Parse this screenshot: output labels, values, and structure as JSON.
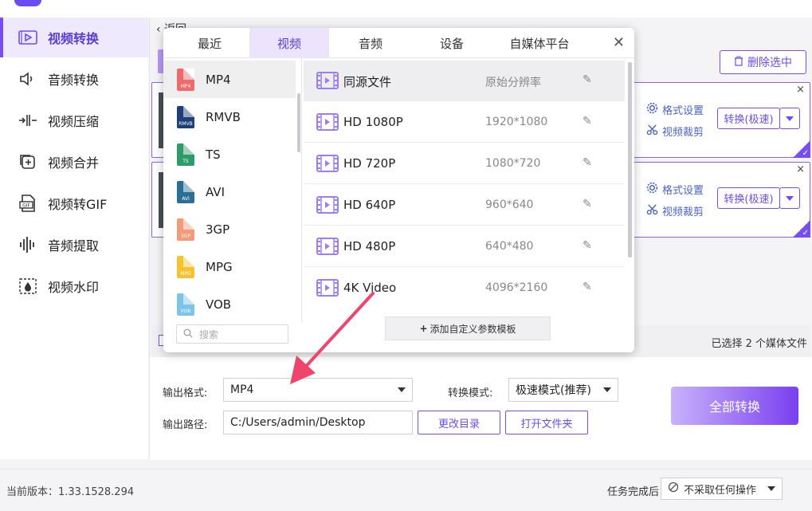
{
  "sidebar": {
    "items": [
      {
        "label": "视频转换",
        "icon": "video-convert-icon",
        "active": true
      },
      {
        "label": "音频转换",
        "icon": "audio-convert-icon"
      },
      {
        "label": "视频压缩",
        "icon": "video-compress-icon"
      },
      {
        "label": "视频合并",
        "icon": "video-merge-icon"
      },
      {
        "label": "视频转GIF",
        "icon": "gif-icon"
      },
      {
        "label": "音频提取",
        "icon": "audio-extract-icon"
      },
      {
        "label": "视频水印",
        "icon": "watermark-icon"
      }
    ]
  },
  "main": {
    "back_label": "返回",
    "delete_selected": "删除选中",
    "cards": [
      {
        "format_settings": "格式设置",
        "crop": "视频裁剪",
        "convert": "转换(极速)"
      },
      {
        "format_settings": "格式设置",
        "crop": "视频裁剪",
        "convert": "转换(极速)"
      }
    ],
    "selected_count": "已选择 2 个媒体文件"
  },
  "output": {
    "format_label": "输出格式:",
    "format_value": "MP4",
    "mode_label": "转换模式:",
    "mode_value": "极速模式(推荐)",
    "path_label": "输出路径:",
    "path_value": "C:/Users/admin/Desktop",
    "change_dir": "更改目录",
    "open_folder": "打开文件夹",
    "convert_all": "全部转换"
  },
  "footer": {
    "version": "当前版本：1.33.1528.294",
    "after_task_label": "任务完成后",
    "after_task_value": "不采取任何操作"
  },
  "popup": {
    "tabs": [
      "最近",
      "视频",
      "音频",
      "设备",
      "自媒体平台"
    ],
    "active_tab": 1,
    "formats": [
      {
        "label": "MP4",
        "tag": "MP4",
        "color": "#ef6b6b"
      },
      {
        "label": "RMVB",
        "tag": "RMVB",
        "color": "#1f3f7a"
      },
      {
        "label": "TS",
        "tag": "TS",
        "color": "#2d9b6a"
      },
      {
        "label": "AVI",
        "tag": "AVI",
        "color": "#2a6f96"
      },
      {
        "label": "3GP",
        "tag": "3GP",
        "color": "#f39a7b"
      },
      {
        "label": "MPG",
        "tag": "MPG",
        "color": "#f5c331"
      },
      {
        "label": "VOB",
        "tag": "VOB",
        "color": "#7cc4ec"
      }
    ],
    "search_placeholder": "搜索",
    "resolutions": [
      {
        "name": "同源文件",
        "value": "原始分辨率"
      },
      {
        "name": "HD 1080P",
        "value": "1920*1080"
      },
      {
        "name": "HD 720P",
        "value": "1080*720"
      },
      {
        "name": "HD 640P",
        "value": "960*640"
      },
      {
        "name": "HD 480P",
        "value": "640*480"
      },
      {
        "name": "4K Video",
        "value": "4096*2160"
      }
    ],
    "add_template": "添加自定义参数模板"
  },
  "colors": {
    "accent": "#7a4df2",
    "link": "#4b63c9",
    "arrow": "#f0456a"
  }
}
